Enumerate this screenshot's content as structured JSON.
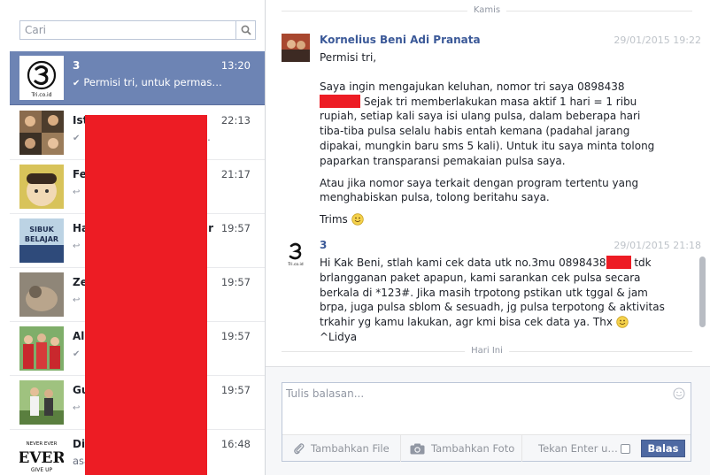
{
  "search": {
    "placeholder": "Cari"
  },
  "conversations": [
    {
      "name": "3",
      "time": "13:20",
      "preview": "Permisi tri, untuk permas…",
      "status": "check",
      "active": true
    },
    {
      "name": "Isti",
      "time": "22:13",
      "preview": "…",
      "status": "check"
    },
    {
      "name": "Fe",
      "time": "21:17",
      "preview": "…",
      "status": "reply"
    },
    {
      "name": "Ha",
      "name_tail": "r",
      "time": "19:57",
      "preview": "…",
      "status": "reply"
    },
    {
      "name": "Ze",
      "time": "19:57",
      "preview": "…",
      "status": "reply"
    },
    {
      "name": "Ali",
      "time": "19:57",
      "preview": "…",
      "status": "check"
    },
    {
      "name": "Gu",
      "time": "19:57",
      "preview": "…",
      "status": "reply"
    },
    {
      "name": "Dir",
      "time": "16:48",
      "preview": "asa",
      "preview_tail": "…",
      "status": "none"
    }
  ],
  "thread": {
    "top_separator": "Kamis",
    "bottom_separator": "Hari Ini",
    "messages": [
      {
        "sender": "Kornelius Beni Adi Pranata",
        "time": "29/01/2015 19:22",
        "greeting": "Permisi tri,",
        "p1_a": "Saya ingin mengajukan keluhan, nomor tri saya 0898438",
        "p1_b": "Sejak tri memberlakukan masa aktif 1 hari = 1 ribu rupiah, setiap kali saya isi ulang pulsa, dalam beberapa hari tiba-tiba pulsa selalu habis entah kemana (padahal jarang dipakai, mungkin baru sms 5 kali). Untuk itu saya minta tolong paparkan transparansi pemakaian pulsa saya.",
        "p2": "Atau jika nomor saya terkait dengan program tertentu yang menghabiskan pulsa, tolong beritahu saya.",
        "p3": "Trims"
      },
      {
        "sender": "3",
        "time": "29/01/2015 21:18",
        "body_a": "Hi Kak Beni, stlah kami cek data utk no.3mu 0898438",
        "body_b": " tdk brlangganan paket apapun, kami sarankan cek pulsa secara berkala di *123#. Jika masih trpotong pstikan utk tggal & jam brpa, juga pulsa sblom & sesuadh, jg pulsa terpotong & aktivitas trkahir yg kamu lakukan, agr kmi bisa cek data ya. Thx",
        "body_c": " ^Lidya"
      }
    ]
  },
  "composer": {
    "placeholder": "Tulis balasan...",
    "add_file": "Tambahkan File",
    "add_photo": "Tambahkan Foto",
    "enter_label": "Tekan Enter u…",
    "send": "Balas"
  },
  "colors": {
    "active_row": "#6d84b4",
    "link": "#3b5998",
    "redaction": "#ed1c24",
    "send_button": "#4e69a2"
  },
  "icons": {
    "search": "search-icon",
    "camera": "camera-icon",
    "paperclip": "paperclip-icon",
    "emoji": "smiley-icon",
    "logo": "tri-logo-icon"
  }
}
